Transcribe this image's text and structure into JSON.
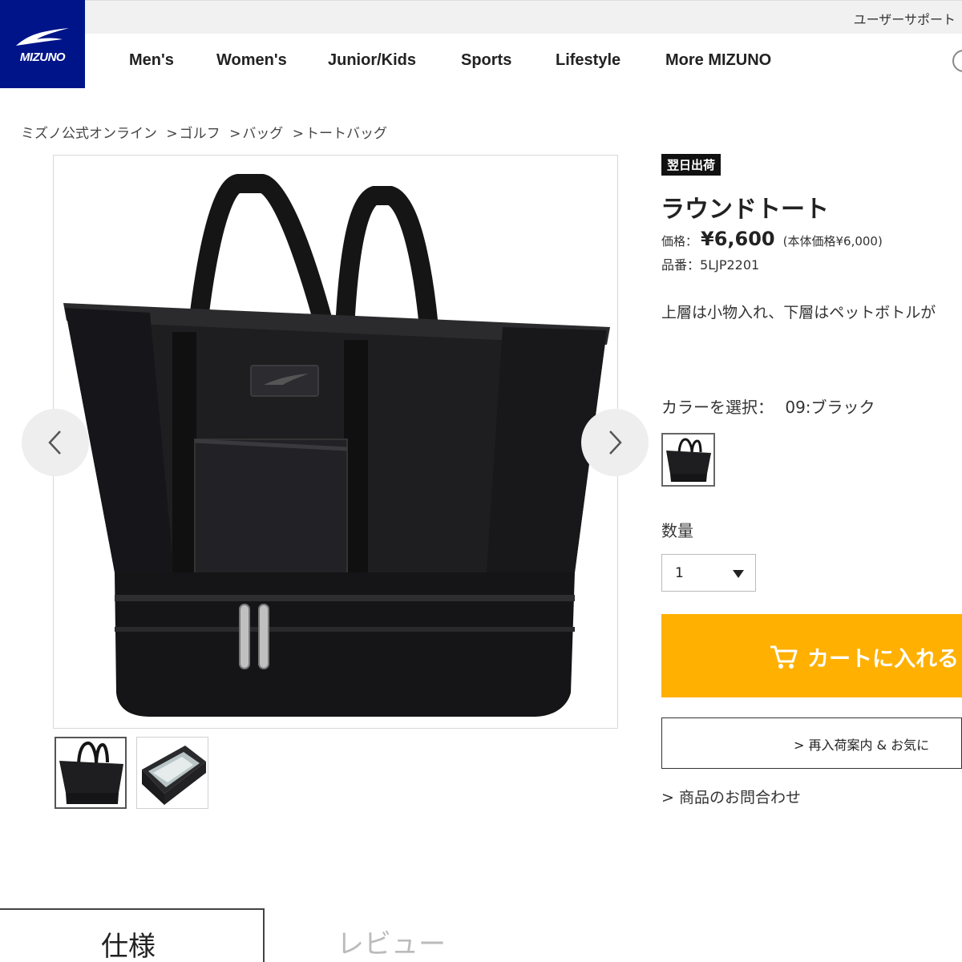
{
  "brand": {
    "logo_text": "MIZUNO",
    "color": "#001489"
  },
  "topbar": {
    "support_link": "ユーザーサポート"
  },
  "nav": {
    "items": [
      "Men's",
      "Women's",
      "Junior/Kids",
      "Sports",
      "Lifestyle",
      "More MIZUNO"
    ]
  },
  "breadcrumb": [
    {
      "label": "ミズノ公式オンライン"
    },
    {
      "label": "ゴルフ"
    },
    {
      "label": "バッグ"
    },
    {
      "label": "トートバッグ"
    }
  ],
  "breadcrumb_sep": ">",
  "gallery": {
    "prev_icon": "chevron-left-icon",
    "next_icon": "chevron-right-icon",
    "thumbnails": 2,
    "active_thumbnail": 1
  },
  "product": {
    "badge": "翌日出荷",
    "title": "ラウンドトート",
    "price_label": "価格：",
    "price": "¥6,600",
    "price_tax_note": "(本体価格¥6,000)",
    "sku_label": "品番：",
    "sku": "5LJP2201",
    "description": "上層は小物入れ、下層はペットボトルが"
  },
  "options": {
    "color_label": "カラーを選択：",
    "color_value": "09:ブラック",
    "quantity_label": "数量",
    "quantity_value": "1"
  },
  "actions": {
    "cart_label": "カートに入れる",
    "cart_color": "#ffb000",
    "restock_label": "> 再入荷案内 & お気に",
    "inquiry_link": "> 商品のお問合わせ"
  },
  "tabs": {
    "spec": "仕様",
    "review": "レビュー"
  }
}
